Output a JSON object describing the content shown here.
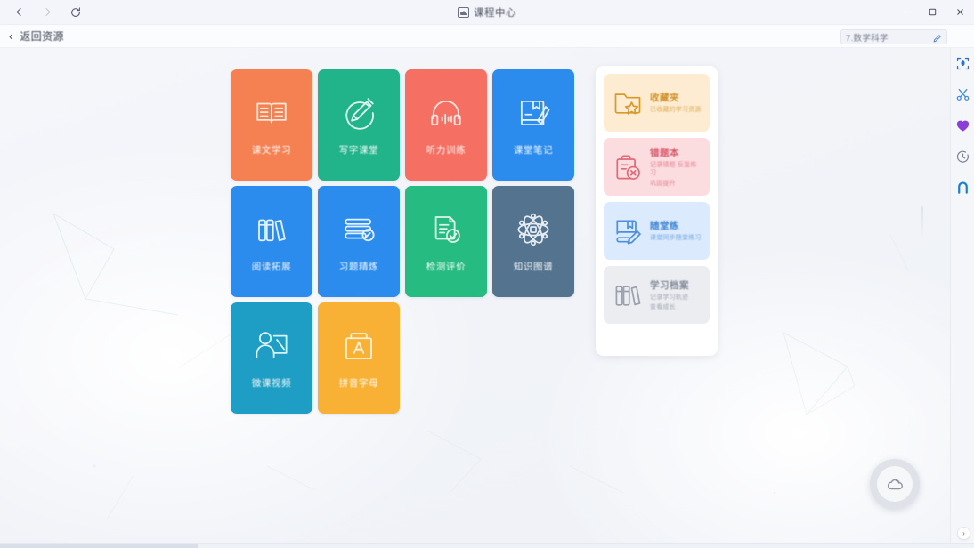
{
  "titlebar": {
    "back_icon": "arrow-left-icon",
    "forward_icon": "arrow-right-icon",
    "refresh_icon": "refresh-icon",
    "app_title": "课程中心",
    "app_title_icon": "presentation-icon",
    "minimize_label": "—",
    "maximize_label": "❐",
    "close_label": "✕"
  },
  "subheader": {
    "back_chevron": "‹",
    "back_label": "返回资源",
    "search_value": "7.数学科学",
    "edit_icon": "pencil-icon"
  },
  "rail": {
    "items": [
      {
        "name": "fullscreen-icon",
        "color": "#2f6fd0"
      },
      {
        "name": "scissors-icon",
        "color": "#3d8bf0"
      },
      {
        "name": "heart-icon",
        "color": "#8b3fd9"
      },
      {
        "name": "clock-icon",
        "color": "#7a8292"
      },
      {
        "name": "magnet-icon",
        "color": "#1a7fd4"
      }
    ]
  },
  "tiles": [
    {
      "label": "课文学习",
      "icon": "open-book-icon",
      "color": "#f58152"
    },
    {
      "label": "写字课堂",
      "icon": "pencil-circle-icon",
      "color": "#21b38a"
    },
    {
      "label": "听力训练",
      "icon": "headphones-wave-icon",
      "color": "#f56f62"
    },
    {
      "label": "课堂笔记",
      "icon": "book-pen-icon",
      "color": "#2b8ced"
    },
    {
      "label": "阅读拓展",
      "icon": "books-stack-icon",
      "color": "#2b8ced"
    },
    {
      "label": "习题精炼",
      "icon": "books-search-icon",
      "color": "#2b8ced"
    },
    {
      "label": "检测评价",
      "icon": "document-check-icon",
      "color": "#26bb80"
    },
    {
      "label": "知识图谱",
      "icon": "atom-icon",
      "color": "#53738f"
    },
    {
      "label": "微课视频",
      "icon": "teacher-board-icon",
      "color": "#1e9ec4"
    },
    {
      "label": "拼音字母",
      "icon": "letter-a-icon",
      "color": "#f8b134"
    }
  ],
  "panel": {
    "cards": [
      {
        "title": "收藏夹",
        "subtitle": "已收藏的学习资源",
        "icon": "folder-star-icon",
        "bg": "#fdecd2",
        "fg": "#d89a2c"
      },
      {
        "title": "错题本",
        "subtitle": "记录错题 反复练习",
        "subtitle2": "巩固提升",
        "icon": "clipboard-x-icon",
        "bg": "#fbdcdf",
        "fg": "#e0697a"
      },
      {
        "title": "随堂练",
        "subtitle": "课堂同步随堂练习",
        "icon": "book-edit-icon",
        "bg": "#dbeafc",
        "fg": "#4b90dd"
      },
      {
        "title": "学习档案",
        "subtitle": "记录学习轨迹",
        "subtitle2": "查看成长",
        "icon": "books-archive-icon",
        "bg": "#ebedf1",
        "fg": "#9aa1ad"
      }
    ]
  },
  "fab": {
    "icon": "cloud-icon",
    "color": "#9aa1ad"
  },
  "bottombar": {
    "expand_label": "›"
  }
}
